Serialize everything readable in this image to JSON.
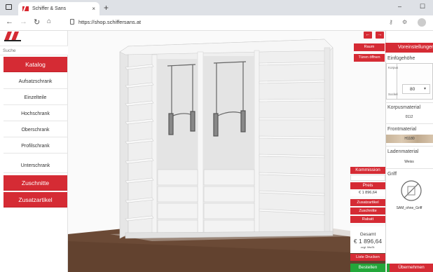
{
  "browser": {
    "tab_title": "Schiffer & Sans",
    "tab_close": "×",
    "new_tab": "+",
    "url": "https://shop.schiffersans.at",
    "min": "–",
    "max": "☐"
  },
  "sidebar": {
    "search_placeholder": "Suche",
    "items": [
      {
        "label": "Katalog",
        "active": true
      },
      {
        "label": "Aufsatzschrank",
        "active": false
      },
      {
        "label": "Einzelteile",
        "active": false
      },
      {
        "label": "Hochschrank",
        "active": false
      },
      {
        "label": "Oberschrank",
        "active": false
      },
      {
        "label": "Profilschrank",
        "active": false
      },
      {
        "label": "Unterschrank",
        "active": false
      },
      {
        "label": "Zuschnitte",
        "active": true
      },
      {
        "label": "Zusatzartikel",
        "active": true
      }
    ]
  },
  "viewport": {
    "raum_button": "Raum",
    "tueren_button": "Türen öffnen"
  },
  "price_panel": {
    "kommission": "Kommission",
    "preis_label": "Preis",
    "preis_value": "€ 1 896,64",
    "zusatzartikel": "Zusatzartikel",
    "zuschnitte": "Zuschnitte",
    "rabatt": "Rabatt",
    "gesamt_label": "Gesamt",
    "gesamt_value": "€ 1 896,64",
    "vat_note": "zzgl. MwSt.",
    "liste_drucken": "Liste Drucken",
    "bestellen": "Bestellen"
  },
  "right_panel": {
    "header": "Voreinstellungen",
    "einfuegehoehe_label": "Einfügehöhe",
    "korpus_label": "Korpus",
    "sockel_label": "Sockel",
    "sockel_value": "80",
    "korpusmaterial_label": "Korpusmaterial",
    "korpusmaterial_value": "0112",
    "frontmaterial_label": "Frontmaterial",
    "frontmaterial_value": "H1180",
    "ladenmaterial_label": "Ladenmaterial",
    "ladenmaterial_value": "Weiss",
    "griff_label": "Griff",
    "griff_value": "SAM_ohne_Griff",
    "uebernehmen": "Übernehmen"
  },
  "colors": {
    "accent_red": "#d52b34",
    "order_green": "#23a63a"
  }
}
